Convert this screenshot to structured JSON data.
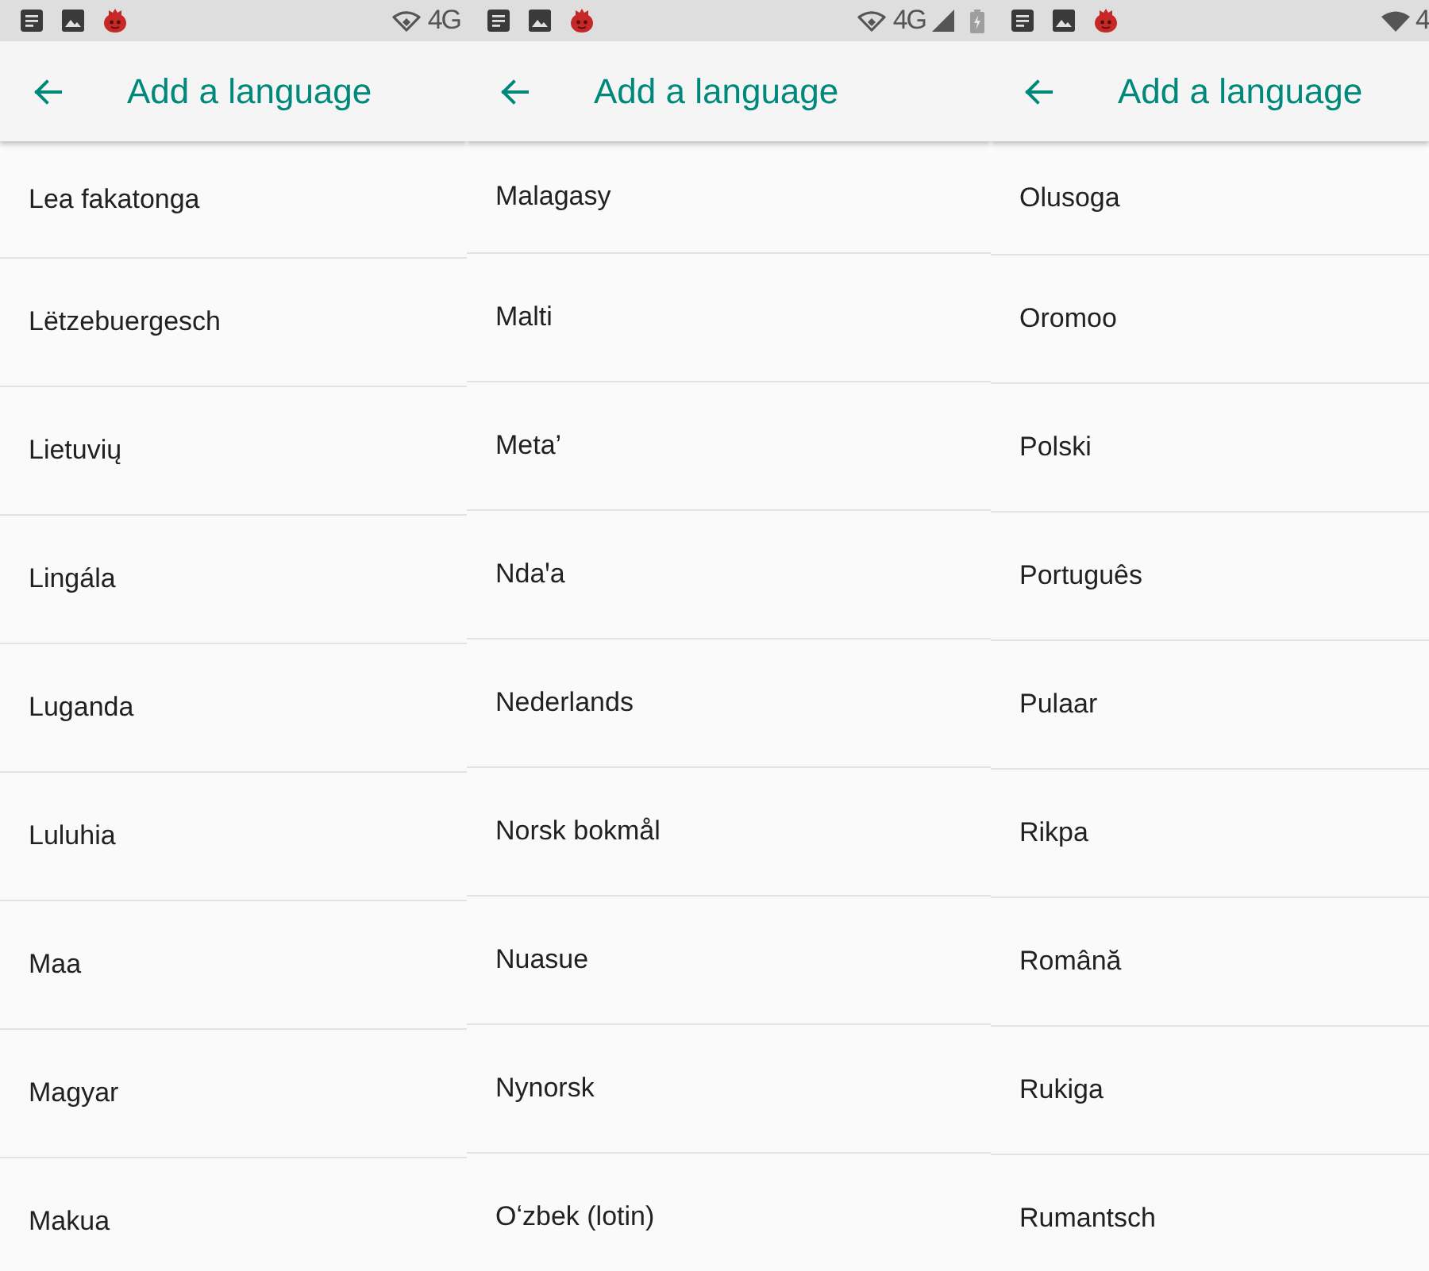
{
  "panels": [
    {
      "status_bar": {
        "network": "4G"
      },
      "toolbar": {
        "title": "Add a language"
      },
      "languages": [
        "Lea fakatonga",
        "Lëtzebuergesch",
        "Lietuvių",
        "Lingála",
        "Luganda",
        "Luluhia",
        "Maa",
        "Magyar",
        "Makua"
      ]
    },
    {
      "status_bar": {
        "network": "4G"
      },
      "toolbar": {
        "title": "Add a language"
      },
      "languages": [
        "Malagasy",
        "Malti",
        "Meta’",
        "Ndaꞌa",
        "Nederlands",
        "Norsk bokmål",
        "Nuasue",
        "Nynorsk",
        "Oʻzbek (lotin)"
      ]
    },
    {
      "status_bar": {
        "network": "4"
      },
      "toolbar": {
        "title": "Add a language"
      },
      "languages": [
        "Olusoga",
        "Oromoo",
        "Polski",
        "Português",
        "Pulaar",
        "Rikpa",
        "Română",
        "Rukiga",
        "Rumantsch"
      ]
    }
  ]
}
